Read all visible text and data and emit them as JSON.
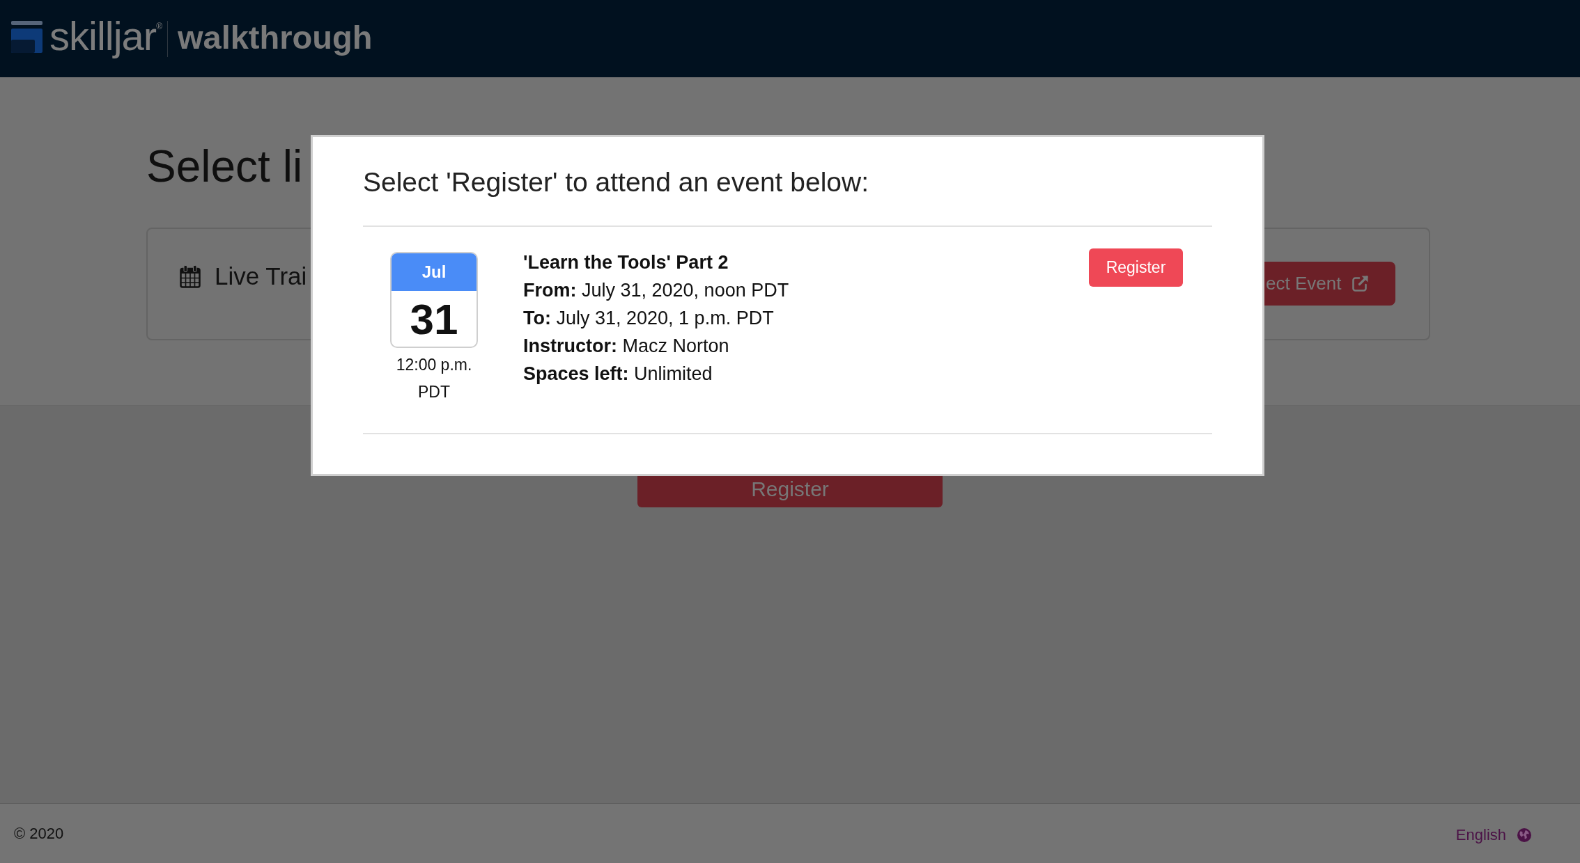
{
  "header": {
    "logo_text": "skilljar$^{®}$",
    "product": "walkthrough"
  },
  "page": {
    "heading": "Select li",
    "event_card": {
      "title": "Live Trai",
      "button": "ect Event"
    },
    "register_button": "Register"
  },
  "modal": {
    "title": "Select 'Register' to attend an event below:",
    "events": [
      {
        "month": "Jul",
        "day": "31",
        "time": "12:00 p.m. PDT",
        "title": "'Learn the Tools' Part 2",
        "details": [
          "**From:** July 31, 2020, noon PDT",
          "**To:** July 31, 2020, 1 p.m. PDT",
          "**Instructor:** Macz Norton",
          "**Spaces left:** Unlimited"
        ],
        "button": "Register"
      }
    ]
  },
  "footer": {
    "copyright": "© 2020",
    "language": "English"
  }
}
